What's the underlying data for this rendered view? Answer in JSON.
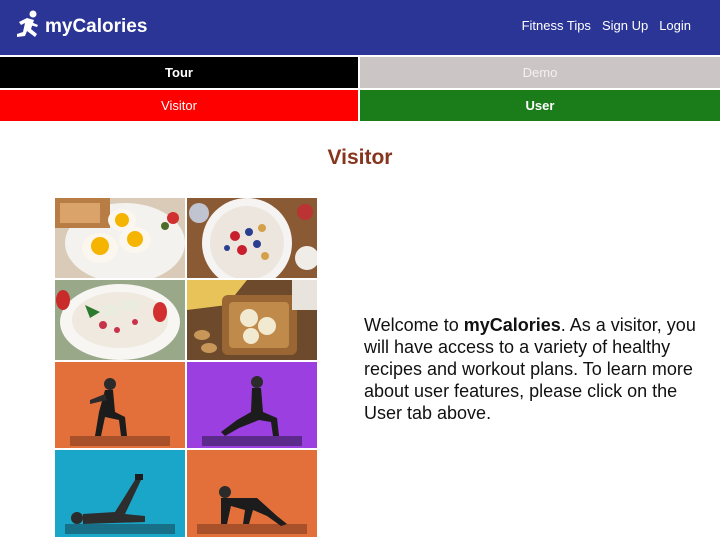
{
  "header": {
    "brand": "myCalories",
    "nav": [
      "Fitness Tips",
      "Sign Up",
      "Login"
    ],
    "bg_color": "#2b3595"
  },
  "tabs": {
    "tour": "Tour",
    "demo": "Demo",
    "visitor": "Visitor",
    "user": "User"
  },
  "page": {
    "title": "Visitor",
    "description_prefix": "Welcome to ",
    "description_brand": "myCalories",
    "description_suffix": ". As a visitor, you will have access to a variety of healthy recipes and workout plans. To learn more about user features, please click on the User tab above."
  },
  "collage": {
    "images": [
      "eggs-toast-plate",
      "berry-granola-bowl",
      "yogurt-strawberry-bowl",
      "banana-peanut-butter-toast",
      "squat-exercise",
      "lunge-exercise",
      "leg-raise-exercise",
      "mountain-climber-exercise"
    ]
  }
}
